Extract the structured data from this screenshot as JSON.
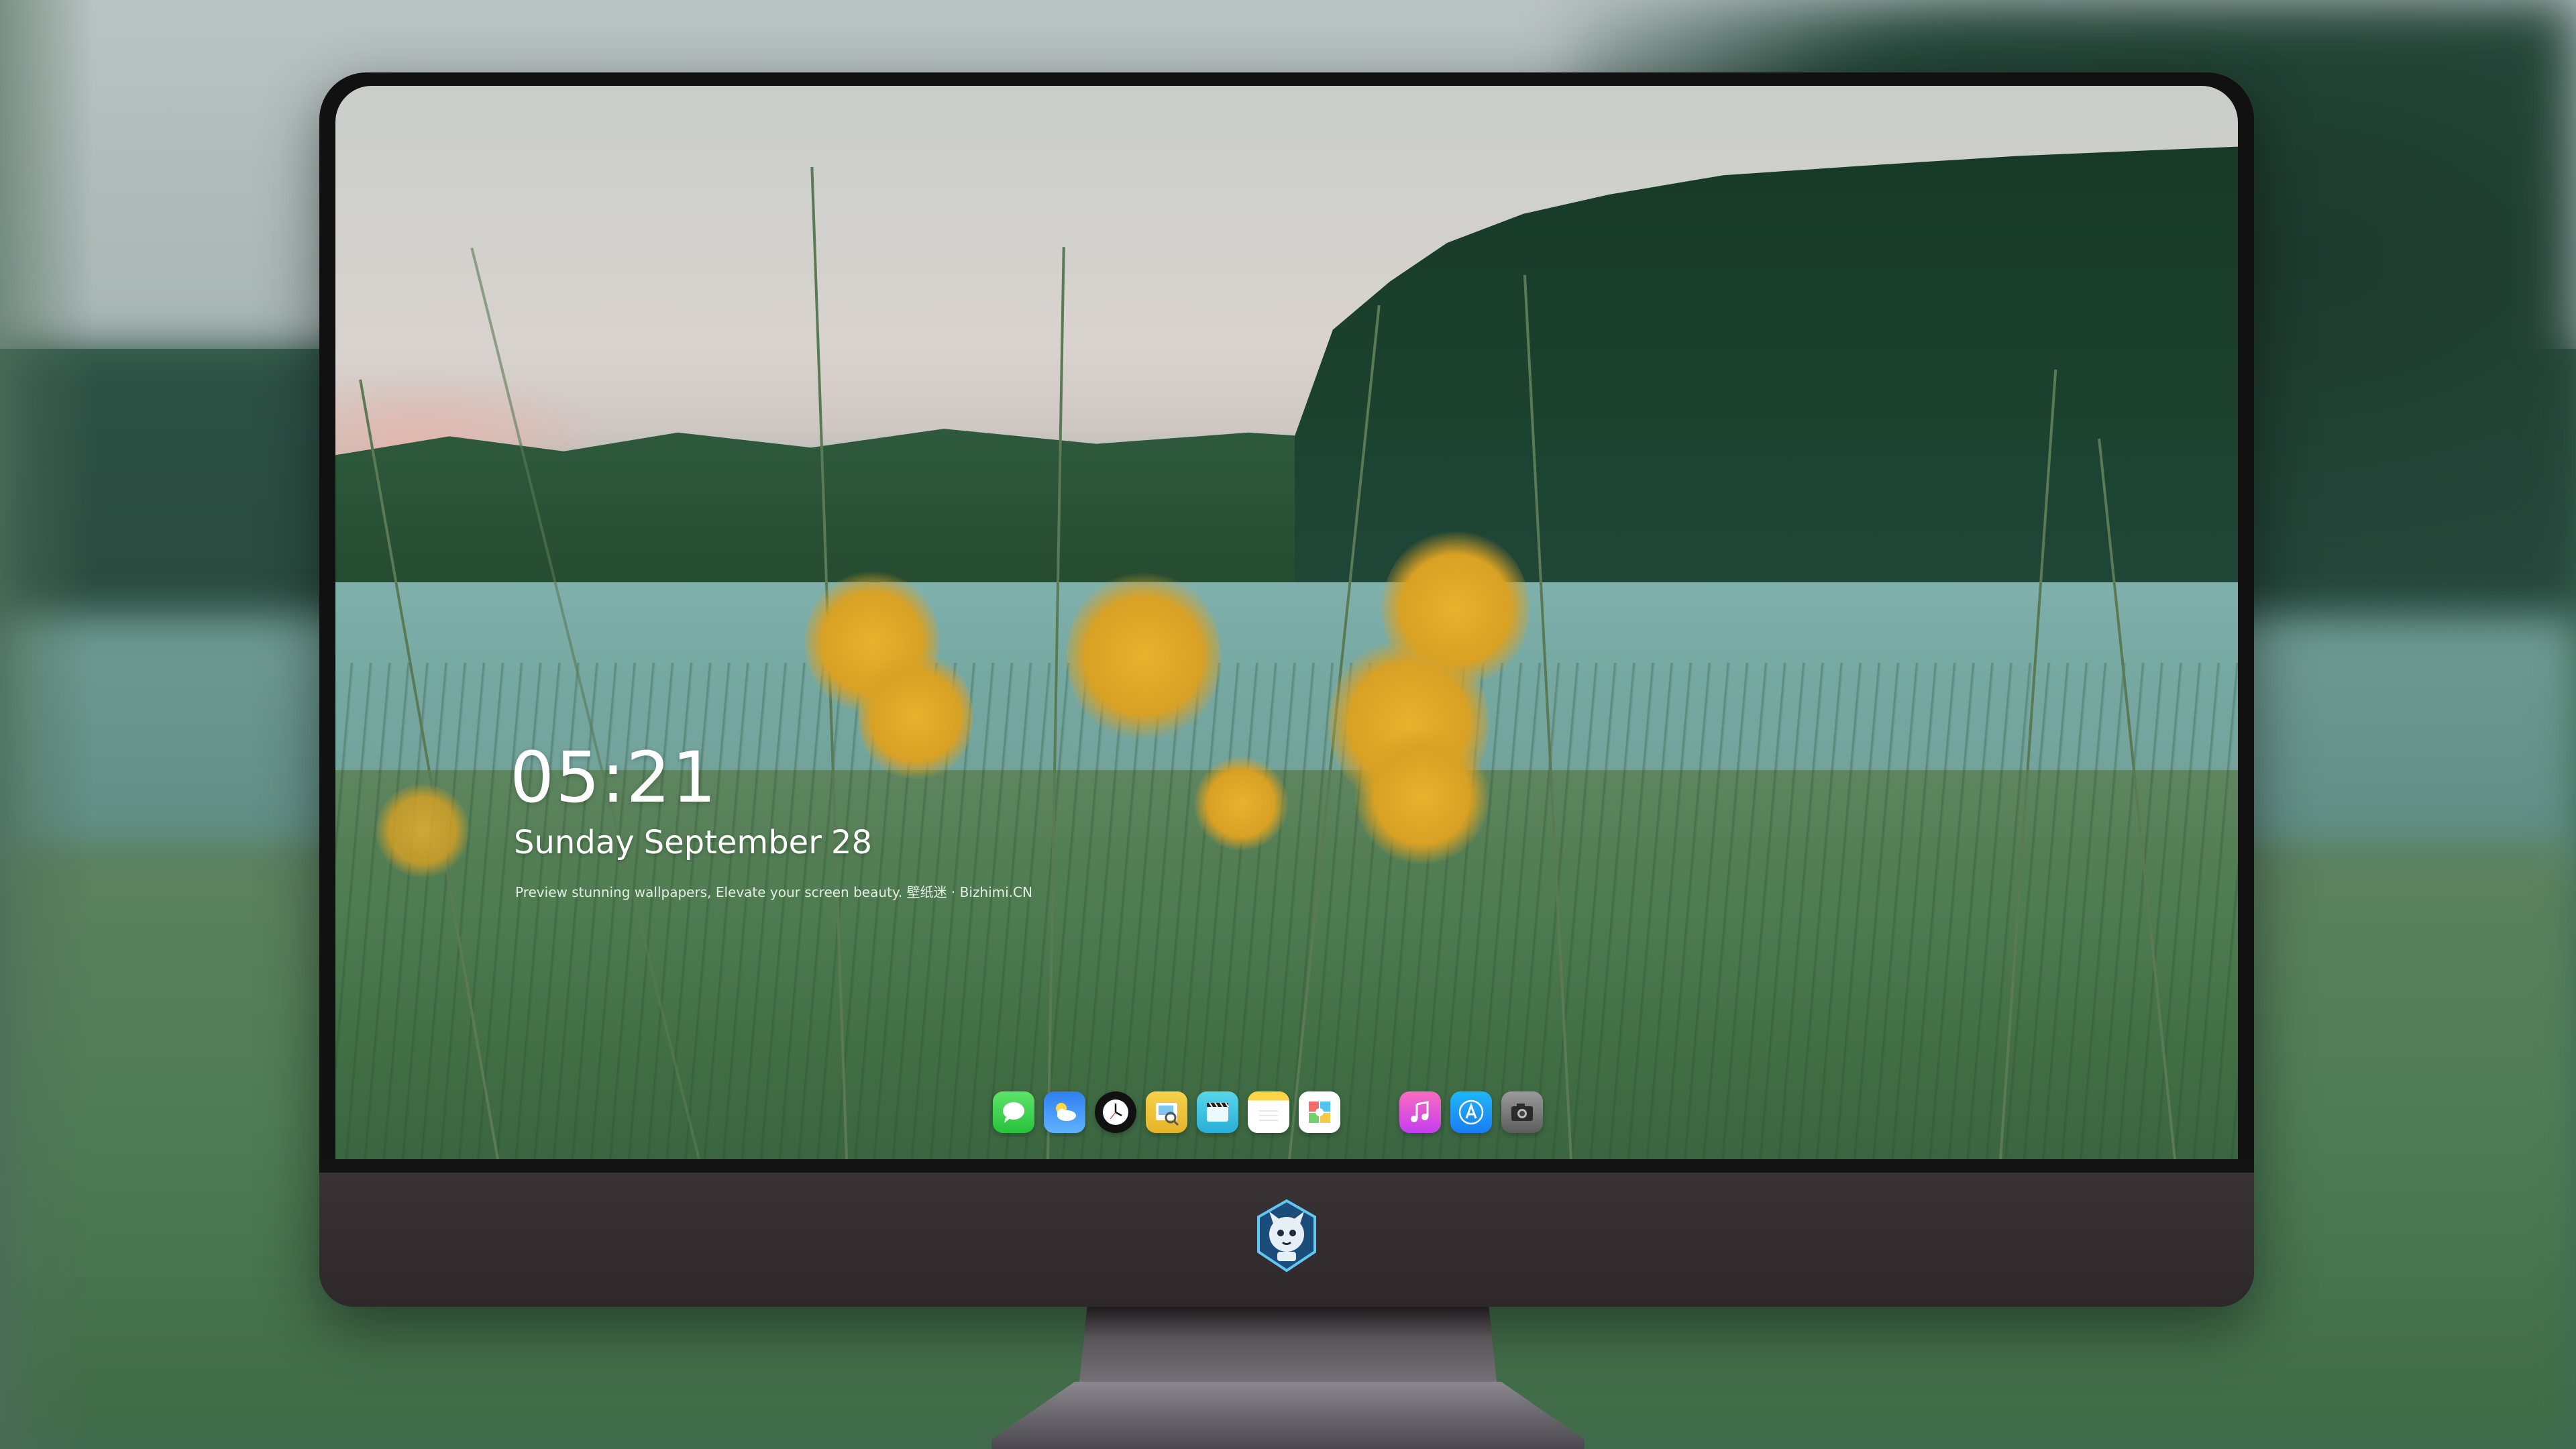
{
  "lock_screen": {
    "time": "05:21",
    "date_weekday": "Sunday",
    "date_month": "September",
    "date_day": "28",
    "tagline": "Preview stunning wallpapers, Elevate your screen beauty. 壁纸迷 · Bizhimi.CN"
  },
  "dock": {
    "apps": [
      {
        "name": "Messages",
        "icon": "messages-icon",
        "color": "#34c759"
      },
      {
        "name": "Weather",
        "icon": "weather-icon",
        "color": "#3a8dff"
      },
      {
        "name": "Clock",
        "icon": "clock-icon",
        "color": "#111111"
      },
      {
        "name": "Preview",
        "icon": "preview-icon",
        "color": "#f2c744"
      },
      {
        "name": "Clips",
        "icon": "clips-icon",
        "color": "#3cc2e0"
      },
      {
        "name": "Notes",
        "icon": "notes-icon",
        "color": "#fbd548"
      },
      {
        "name": "Photo Booth",
        "icon": "photos-icon",
        "color": "#ffffff"
      },
      {
        "name": "Music",
        "icon": "music-icon",
        "color": "#e24fd4"
      },
      {
        "name": "App Store",
        "icon": "app-store-icon",
        "color": "#1a8cf5"
      },
      {
        "name": "Camera",
        "icon": "camera-icon",
        "color": "#7a7a7a"
      }
    ]
  },
  "monitor": {
    "chin_logo": "mascot-logo-icon"
  }
}
